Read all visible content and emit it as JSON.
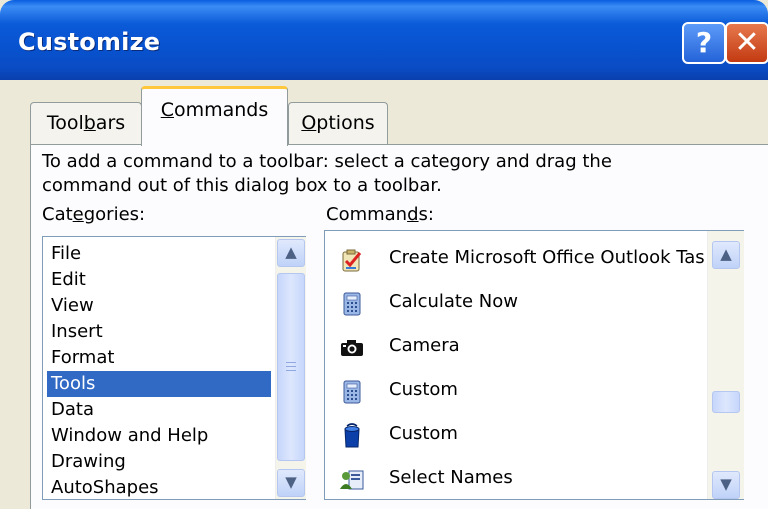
{
  "window": {
    "title": "Customize",
    "help_label": "?",
    "close_label": "✕"
  },
  "tabs": [
    {
      "pre": "Tool",
      "key": "b",
      "post": "ars",
      "active": false
    },
    {
      "pre": "",
      "key": "C",
      "post": "ommands",
      "active": true
    },
    {
      "pre": "",
      "key": "O",
      "post": "ptions",
      "active": false
    }
  ],
  "hint": {
    "line1": "To add a command to a toolbar: select a category and drag the",
    "line2": "command out of this dialog box to a toolbar."
  },
  "categories_label": {
    "pre": "Cat",
    "key": "e",
    "post": "gories:"
  },
  "commands_label": {
    "pre": "Comman",
    "key": "d",
    "post": "s:"
  },
  "categories": [
    "File",
    "Edit",
    "View",
    "Insert",
    "Format",
    "Tools",
    "Data",
    "Window and Help",
    "Drawing",
    "AutoShapes"
  ],
  "selected_category": "Tools",
  "commands": [
    {
      "label": "Create Microsoft Office Outlook Task",
      "icon": "outlook-task-icon"
    },
    {
      "label": "Calculate Now",
      "icon": "calculator-icon"
    },
    {
      "label": "Camera",
      "icon": "camera-icon"
    },
    {
      "label": "Custom",
      "icon": "calculator-icon"
    },
    {
      "label": "Custom",
      "icon": "blue-bucket-icon"
    },
    {
      "label": "Select Names",
      "icon": "address-book-icon"
    }
  ],
  "colors": {
    "title_bar": "#0a52d0",
    "selection": "#316ac5",
    "tab_highlight": "#ffc83c",
    "close_button": "#c33a12"
  }
}
